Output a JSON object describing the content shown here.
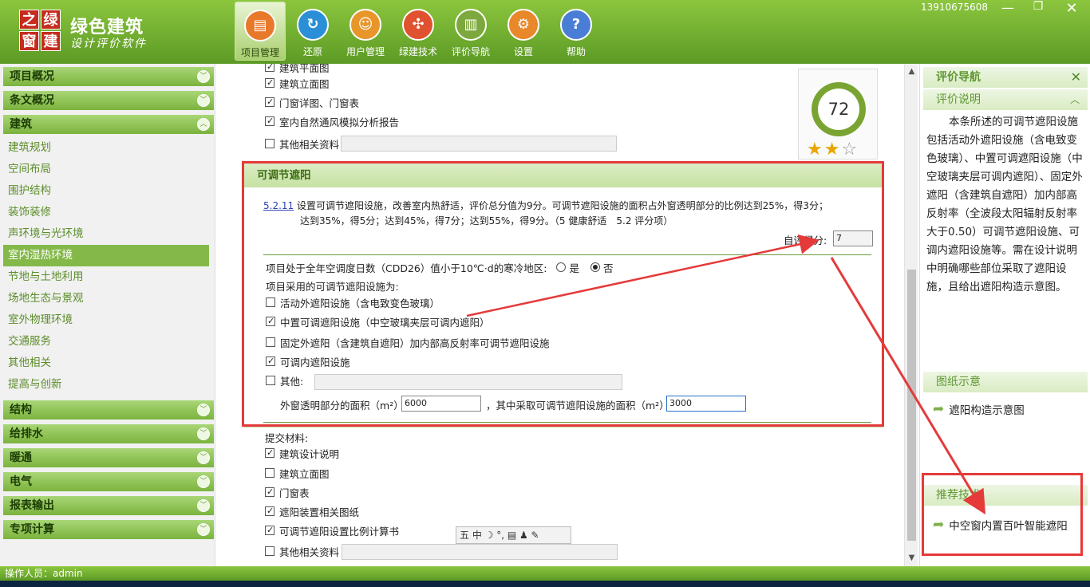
{
  "app": {
    "logo_chars": [
      "之",
      "绿",
      "窗",
      "建"
    ],
    "title": "绿色建筑",
    "subtitle": "设计评价软件",
    "user": "13910675608"
  },
  "toolbar": [
    {
      "label": "项目管理",
      "icon": "folder-icon",
      "glyph": "▤",
      "color": "#e8782a",
      "active": true
    },
    {
      "label": "还原",
      "icon": "refresh-icon",
      "glyph": "↻",
      "color": "#2a8fd6",
      "active": false
    },
    {
      "label": "用户管理",
      "icon": "users-icon",
      "glyph": "☺",
      "color": "#e8962a",
      "active": false
    },
    {
      "label": "绿建技术",
      "icon": "molecule-icon",
      "glyph": "✣",
      "color": "#e0512f",
      "active": false
    },
    {
      "label": "评价导航",
      "icon": "book-icon",
      "glyph": "▥",
      "color": "#7da83d",
      "active": false
    },
    {
      "label": "设置",
      "icon": "gear-icon",
      "glyph": "⚙",
      "color": "#e8882a",
      "active": false
    },
    {
      "label": "帮助",
      "icon": "help-icon",
      "glyph": "?",
      "color": "#4a7ed6",
      "active": false
    }
  ],
  "sidebar": {
    "groups_top": [
      {
        "label": "项目概况",
        "expanded": false
      },
      {
        "label": "条文概况",
        "expanded": false
      },
      {
        "label": "建筑",
        "expanded": true
      }
    ],
    "items": [
      "建筑规划",
      "空间布局",
      "围护结构",
      "装饰装修",
      "声环境与光环境",
      "室内湿热环境",
      "节地与土地利用",
      "场地生态与景观",
      "室外物理环境",
      "交通服务",
      "其他相关",
      "提高与创新"
    ],
    "selected_index": 5,
    "groups_bottom": [
      {
        "label": "结构"
      },
      {
        "label": "给排水"
      },
      {
        "label": "暖通"
      },
      {
        "label": "电气"
      },
      {
        "label": "报表输出"
      },
      {
        "label": "专项计算"
      }
    ]
  },
  "main": {
    "top_checks": [
      {
        "label": "建筑平面图",
        "checked": true
      },
      {
        "label": "建筑立面图",
        "checked": true
      },
      {
        "label": "门窗详图、门窗表",
        "checked": true
      },
      {
        "label": "室内自然通风模拟分析报告",
        "checked": true
      },
      {
        "label": "其他相关资料",
        "checked": false
      }
    ],
    "score": {
      "value": "72",
      "stars_on": 2,
      "stars_total": 3
    },
    "section_title": "可调节遮阳",
    "clause_code": "5.2.11",
    "clause_line1": "设置可调节遮阳设施，改善室内热舒适，评价总分值为9分。可调节遮阳设施的面积占外窗透明部分的比例达到25%，得3分；",
    "clause_line2": "达到35%，得5分；达到45%，得7分；达到55%，得9分。（5 健康舒适　5.2 评分项）",
    "self_score_label": "自评得分:",
    "self_score_value": "7",
    "cold_question": "项目处于全年空调度日数（CDD26）值小于10℃·d的寒冷地区:",
    "radio_yes": "是",
    "radio_no": "否",
    "facility_label": "项目采用的可调节遮阳设施为:",
    "facilities": [
      {
        "label": "活动外遮阳设施（含电致变色玻璃）",
        "checked": false
      },
      {
        "label": "中置可调遮阳设施（中空玻璃夹层可调内遮阳）",
        "checked": true
      },
      {
        "label": "固定外遮阳（含建筑自遮阳）加内部高反射率可调节遮阳设施",
        "checked": false
      },
      {
        "label": "可调内遮阳设施",
        "checked": true
      },
      {
        "label": "其他:",
        "checked": false
      }
    ],
    "area_label1": "外窗透明部分的面积（m²）",
    "area_value1": "6000",
    "area_label2": "，其中采取可调节遮阳设施的面积（m²）",
    "area_value2": "3000",
    "submit_label": "提交材料:",
    "submit_checks": [
      {
        "label": "建筑设计说明",
        "checked": true
      },
      {
        "label": "建筑立面图",
        "checked": false
      },
      {
        "label": "门窗表",
        "checked": true
      },
      {
        "label": "遮阳装置相关图纸",
        "checked": true
      },
      {
        "label": "可调节遮阳设置比例计算书",
        "checked": true
      },
      {
        "label": "其他相关资料",
        "checked": false
      }
    ]
  },
  "right": {
    "title": "评价导航",
    "desc_title": "评价说明",
    "desc": "本条所述的可调节遮阳设施包括活动外遮阳设施（含电致变色玻璃）、中置可调遮阳设施（中空玻璃夹层可调内遮阳）、固定外遮阳（含建筑自遮阳）加内部高反射率（全波段太阳辐射反射率大于0.50）可调节遮阳设施、可调内遮阳设施等。需在设计说明中明确哪些部位采取了遮阳设施，且给出遮阳构造示意图。",
    "drawing_title": "图纸示意",
    "drawing_link": "遮阳构造示意图",
    "recommend_title": "推荐技术",
    "recommend_link": "中空窗内置百叶智能遮阳"
  },
  "status": {
    "operator": "操作人员：admin"
  },
  "ime": {
    "text": "五 中 ☽ °, ▤ ♟ ✎"
  },
  "colors": {
    "accent": "#7bb33e",
    "annotation": "#e53a3a"
  }
}
